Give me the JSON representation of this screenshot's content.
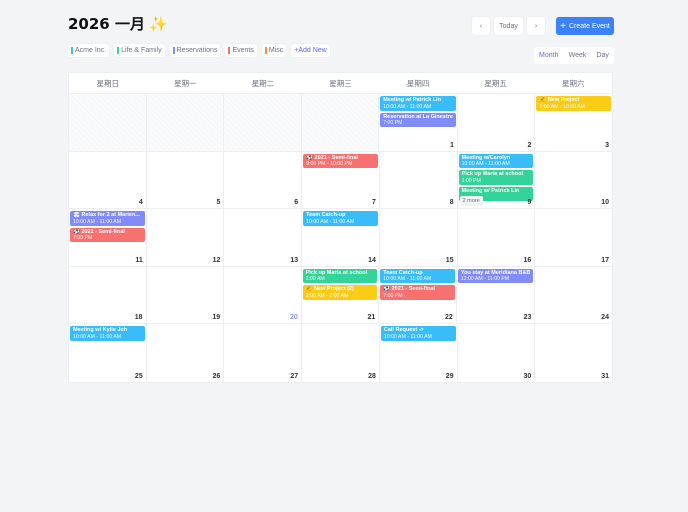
{
  "header": {
    "title": "2026 一月",
    "sparkle": "✨",
    "prev": "‹",
    "today": "Today",
    "next": "›",
    "create_icon": "+",
    "create": "Create Event"
  },
  "categories": [
    {
      "label": "Acme Inc.",
      "color": "#38bdf8"
    },
    {
      "label": "Life & Family",
      "color": "#34d399"
    },
    {
      "label": "Reservations",
      "color": "#818cf8"
    },
    {
      "label": "Events",
      "color": "#f87171"
    },
    {
      "label": "Misc",
      "color": "#fb923c"
    }
  ],
  "add_new": "+Add New",
  "views": [
    "Month",
    "Week",
    "Day"
  ],
  "active_view": "Month",
  "weekdays": [
    "星期日",
    "星期一",
    "星期二",
    "星期三",
    "星期四",
    "星期五",
    "星期六"
  ],
  "today": 20,
  "colors": {
    "blue": "#38bdf8",
    "purple": "#818cf8",
    "red": "#f87171",
    "green": "#34d399",
    "yellow": "#facc15"
  },
  "weeks": [
    [
      null,
      null,
      null,
      null,
      {
        "day": 1,
        "events": [
          {
            "title": "Meeting w/ Patrick Lin",
            "time": "10:00 AM - 11:00 AM",
            "color": "blue"
          },
          {
            "title": "Reservation at La Ginestre",
            "time": "7:00 PM",
            "color": "purple"
          }
        ]
      },
      {
        "day": 2,
        "events": []
      },
      {
        "day": 3,
        "events": [
          {
            "title": "✍ New Project",
            "time": "9:00 AM - 10:00 AM",
            "color": "yellow"
          }
        ]
      }
    ],
    [
      {
        "day": 4,
        "events": []
      },
      {
        "day": 5,
        "events": []
      },
      {
        "day": 6,
        "events": []
      },
      {
        "day": 7,
        "events": [
          {
            "title": "⚽ 2021 - Semi-final",
            "time": "9:00 PM - 10:00 PM",
            "color": "red"
          }
        ]
      },
      {
        "day": 8,
        "events": []
      },
      {
        "day": 9,
        "events": [
          {
            "title": "Meeting w/Carolyn",
            "time": "10:00 AM - 11:00 AM",
            "color": "blue"
          },
          {
            "title": "Pick up Marta at school",
            "time": "1:00 PM",
            "color": "green"
          },
          {
            "title": "Meeting w/ Patrick Lin",
            "time": "",
            "color": "green"
          }
        ],
        "more": "2 more"
      },
      {
        "day": 10,
        "events": []
      }
    ],
    [
      {
        "day": 11,
        "events": [
          {
            "title": "🏖 Relax for 2 at Marien...",
            "time": "10:00 AM - 11:00 AM",
            "color": "purple"
          },
          {
            "title": "⚽ 2021 - Semi-final",
            "time": "7:00 PM",
            "color": "red"
          }
        ]
      },
      {
        "day": 12,
        "events": []
      },
      {
        "day": 13,
        "events": []
      },
      {
        "day": 14,
        "events": [
          {
            "title": "Team Catch-up",
            "time": "10:00 AM - 11:00 AM",
            "color": "blue"
          }
        ]
      },
      {
        "day": 15,
        "events": []
      },
      {
        "day": 16,
        "events": []
      },
      {
        "day": 17,
        "events": []
      }
    ],
    [
      {
        "day": 18,
        "events": []
      },
      {
        "day": 19,
        "events": []
      },
      {
        "day": 20,
        "events": []
      },
      {
        "day": 21,
        "events": [
          {
            "title": "Pick up Marta at school",
            "time": "2:00 AM",
            "color": "green"
          },
          {
            "title": "✍ New Project (2)",
            "time": "2:00 AM - 7:00 AM",
            "color": "yellow"
          }
        ]
      },
      {
        "day": 22,
        "events": [
          {
            "title": "Team Catch-up",
            "time": "10:00 AM - 11:00 AM",
            "color": "blue"
          },
          {
            "title": "⚽ 2021 - Semi-final",
            "time": "7:00 PM",
            "color": "red"
          }
        ]
      },
      {
        "day": 23,
        "events": [
          {
            "title": "You stay at Meridiana B&B",
            "time": "12:00 AM - 11:00 PM",
            "color": "purple"
          }
        ]
      },
      {
        "day": 24,
        "events": []
      }
    ],
    [
      {
        "day": 25,
        "events": [
          {
            "title": "Meeting w/ Kylie Joh",
            "time": "10:00 AM - 11:00 AM",
            "color": "blue"
          }
        ]
      },
      {
        "day": 26,
        "events": []
      },
      {
        "day": 27,
        "events": []
      },
      {
        "day": 28,
        "events": []
      },
      {
        "day": 29,
        "events": [
          {
            "title": "Call Request ->",
            "time": "10:00 AM - 11:00 AM",
            "color": "blue"
          }
        ]
      },
      {
        "day": 30,
        "events": []
      },
      {
        "day": 31,
        "events": []
      }
    ]
  ]
}
